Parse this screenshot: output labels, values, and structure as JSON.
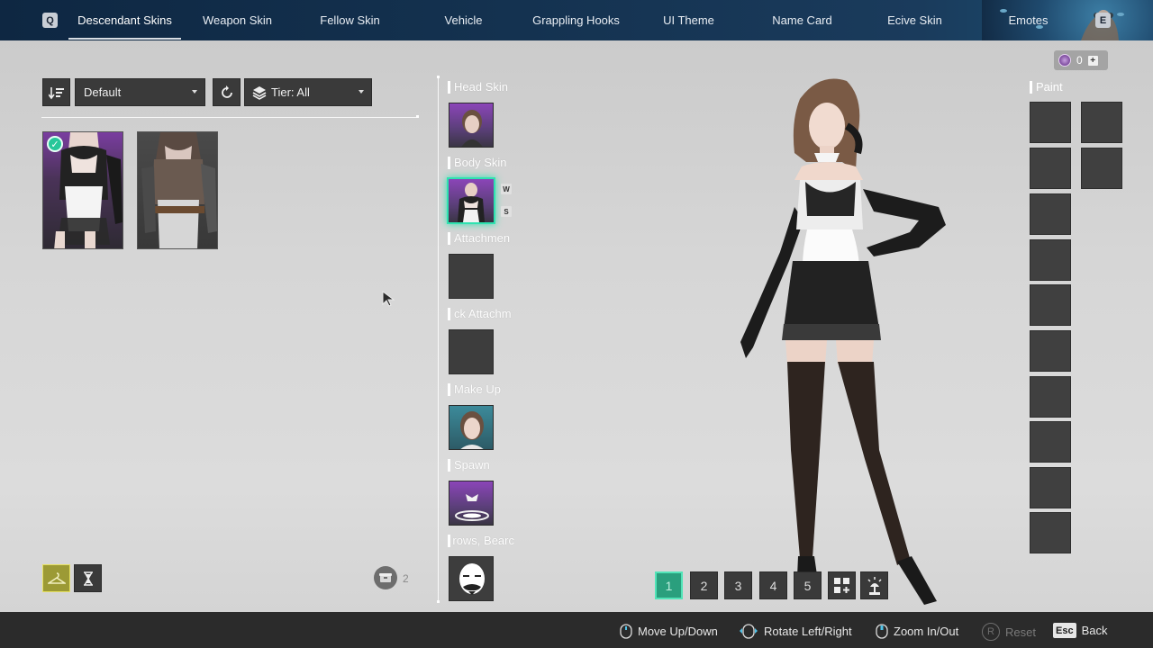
{
  "topnav": {
    "left_key": "Q",
    "right_key": "E",
    "tabs": [
      {
        "label": "Descendant Skins",
        "active": true
      },
      {
        "label": "Weapon Skin"
      },
      {
        "label": "Fellow Skin"
      },
      {
        "label": "Vehicle"
      },
      {
        "label": "Grappling Hooks"
      },
      {
        "label": "UI Theme"
      },
      {
        "label": "Name Card"
      },
      {
        "label": "Ecive Skin"
      },
      {
        "label": "Emotes"
      }
    ]
  },
  "filters": {
    "sort_value": "Default",
    "tier_value": "Tier: All"
  },
  "skins": {
    "count": "2"
  },
  "sections": [
    {
      "label": "Head Skin"
    },
    {
      "label": "Body Skin",
      "badges": [
        "W",
        "S"
      ]
    },
    {
      "label": "Attachmen"
    },
    {
      "label": "ck Attachm"
    },
    {
      "label": "Make Up"
    },
    {
      "label": "Spawn"
    },
    {
      "label": "rows, Bearc"
    }
  ],
  "paint": {
    "label": "Paint",
    "currency_amount": "0"
  },
  "presets": [
    "1",
    "2",
    "3",
    "4",
    "5"
  ],
  "hints": {
    "move": "Move Up/Down",
    "rotate": "Rotate Left/Right",
    "zoom": "Zoom In/Out",
    "reset_key": "R",
    "reset": "Reset",
    "back_key": "Esc",
    "back": "Back"
  },
  "colors": {
    "accent_green": "#2fe2b0",
    "nav_bg": "#143250",
    "slot_purple": "#8b45b8"
  }
}
